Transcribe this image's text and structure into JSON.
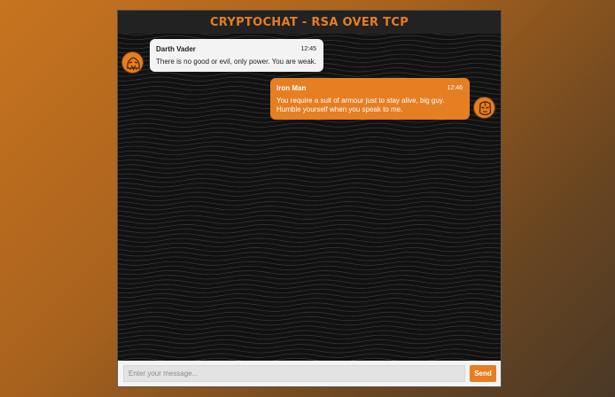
{
  "app": {
    "title": "CRYPTOCHAT - RSA OVER TCP"
  },
  "messages": [
    {
      "sender": "Darth Vader",
      "time": "12:45",
      "text": "There is no good or evil, only power. You are weak.",
      "side": "left",
      "avatar_icon": "darth-vader-helmet-icon"
    },
    {
      "sender": "Iron Man",
      "time": "12:46",
      "text_lines": [
        "You require a suit of armour just to stay alive, big guy.",
        "Humble yourself when you speak to me."
      ],
      "side": "right",
      "avatar_icon": "iron-man-helmet-icon"
    }
  ],
  "composer": {
    "placeholder": "Enter your message...",
    "send_label": "Send"
  },
  "colors": {
    "accent": "#e67e22",
    "chat_background": "#111111",
    "titlebar": "#222222"
  }
}
